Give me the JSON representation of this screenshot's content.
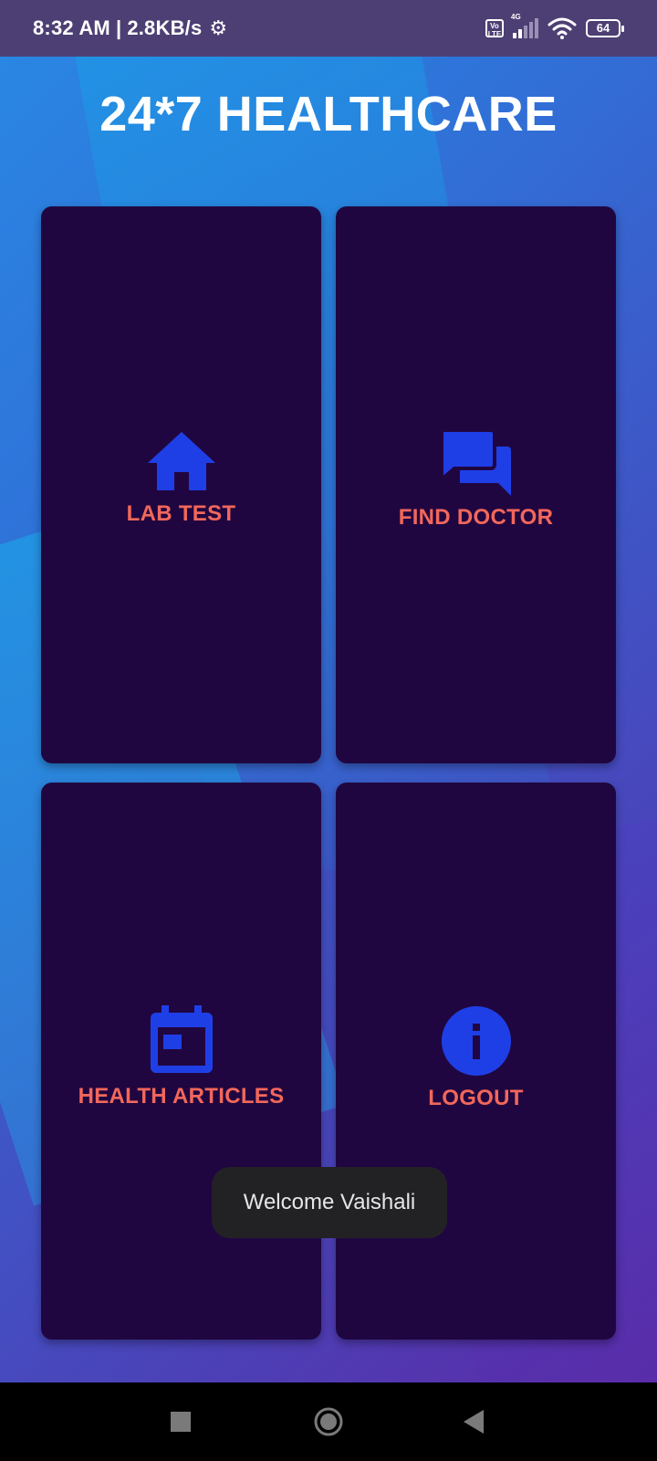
{
  "status_bar": {
    "time": "8:32 AM",
    "separator": "|",
    "net_speed": "2.8KB/s",
    "volte": "Vo LTE",
    "network_type": "4G",
    "battery_level": "64",
    "icons": [
      "gear-icon",
      "volte-icon",
      "signal-icon",
      "wifi-icon",
      "battery-icon"
    ]
  },
  "app": {
    "title": "24*7 HEALTHCARE",
    "tiles": [
      {
        "label": "LAB TEST",
        "icon": "home-icon"
      },
      {
        "label": "FIND DOCTOR",
        "icon": "chat-bubbles-icon"
      },
      {
        "label": "HEALTH ARTICLES",
        "icon": "calendar-icon"
      },
      {
        "label": "LOGOUT",
        "icon": "info-icon"
      }
    ]
  },
  "toast": {
    "message": "Welcome Vaishali"
  },
  "nav_bar": {
    "icons": [
      "recents-icon",
      "home-circle-icon",
      "back-icon"
    ]
  },
  "colors": {
    "tile_bg": "#200640",
    "tile_label": "#f2675b",
    "icon": "#1f3fe6",
    "status_bar": "#4d3f73"
  }
}
